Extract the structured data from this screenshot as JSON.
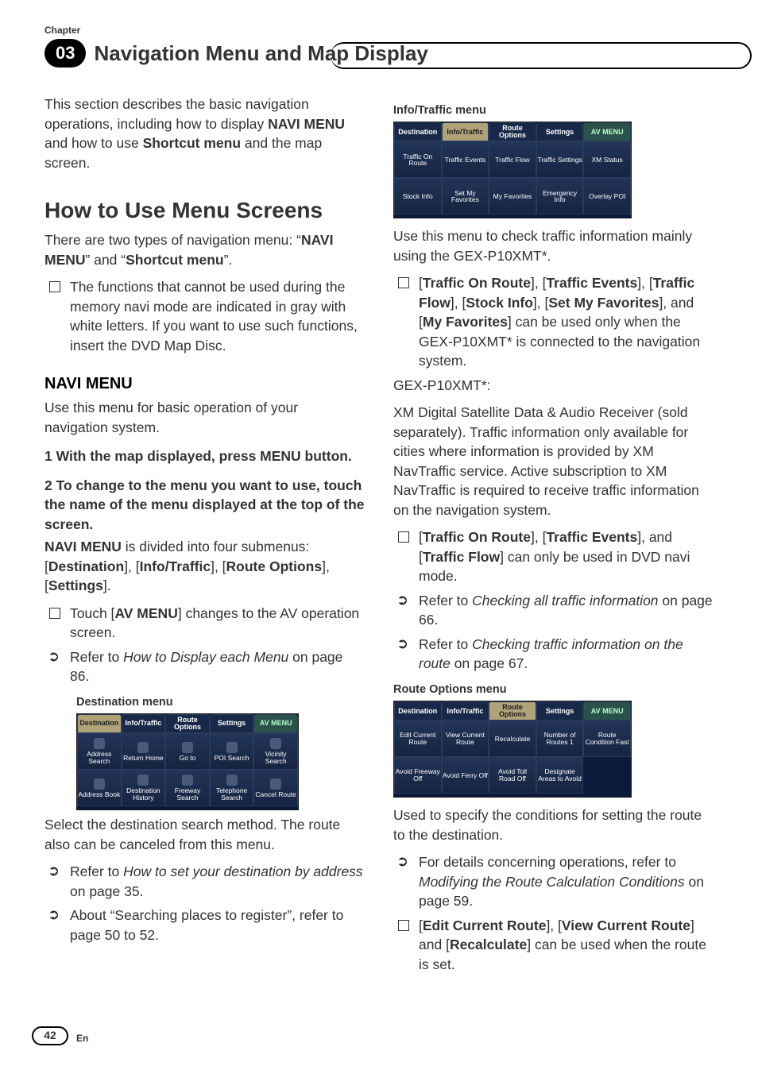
{
  "header": {
    "chapter_label": "Chapter",
    "chapter_num": "03",
    "chapter_title": "Navigation Menu and Map Display"
  },
  "left": {
    "intro": "This section describes the basic navigation operations, including how to display ",
    "intro_bold1": "NAVI MENU",
    "intro_mid": " and how to use ",
    "intro_bold2": "Shortcut menu",
    "intro_end": " and the map screen.",
    "h1": "How to Use Menu Screens",
    "p1_a": "There are two types of navigation menu: “",
    "p1_b": "NAVI MENU",
    "p1_c": "” and “",
    "p1_d": "Shortcut menu",
    "p1_e": "”.",
    "note1": "The functions that cannot be used during the memory navi mode are indicated in gray with white letters. If you want to use such functions, insert the DVD Map Disc.",
    "h2": "NAVI MENU",
    "p2": "Use this menu for basic operation of your navigation system.",
    "step1": "1    With the map displayed, press MENU button.",
    "step2": "2    To change to the menu you want to use, touch the name of the menu displayed at the top of the screen.",
    "p3_a": "NAVI MENU",
    "p3_b": " is divided into four submenus: [",
    "p3_c": "Destination",
    "p3_d": "], [",
    "p3_e": "Info/Traffic",
    "p3_f": "], [",
    "p3_g": "Route Options",
    "p3_h": "], [",
    "p3_i": "Settings",
    "p3_j": "].",
    "b1_a": "Touch [",
    "b1_b": "AV MENU",
    "b1_c": "] changes to the AV operation screen.",
    "b2_a": "Refer to ",
    "b2_b": "How to Display each Menu",
    "b2_c": " on page 86.",
    "caption1": "Destination menu",
    "p4": "Select the destination search method. The route also can be canceled from this menu.",
    "b3_a": "Refer to ",
    "b3_b": "How to set your destination by address",
    "b3_c": " on page 35.",
    "b4": "About “Searching places to register”, refer to page 50 to 52."
  },
  "right": {
    "caption1": "Info/Traffic menu",
    "p1": "Use this menu to check traffic information mainly using the GEX-P10XMT*.",
    "b1_a": "[",
    "b1_b": "Traffic On Route",
    "b1_c": "], [",
    "b1_d": "Traffic Events",
    "b1_e": "], [",
    "b1_f": "Traffic Flow",
    "b1_g": "], [",
    "b1_h": "Stock Info",
    "b1_i": "], [",
    "b1_j": "Set My Favorites",
    "b1_k": "], and [",
    "b1_l": "My Favorites",
    "b1_m": "] can be used only when the GEX-P10XMT* is connected to the navigation system.",
    "p2": "GEX-P10XMT*:",
    "p3": "XM Digital Satellite Data & Audio Receiver (sold separately). Traffic information only available for cities where information is provided by XM NavTraffic service. Active subscription to XM NavTraffic is required to receive traffic information on the navigation system.",
    "b2_a": "[",
    "b2_b": "Traffic On Route",
    "b2_c": "], [",
    "b2_d": "Traffic Events",
    "b2_e": "], and [",
    "b2_f": "Traffic Flow",
    "b2_g": "] can only be used in DVD navi mode.",
    "b3_a": "Refer to ",
    "b3_b": "Checking all traffic information",
    "b3_c": " on page 66.",
    "b4_a": "Refer to ",
    "b4_b": "Checking traffic information on the route",
    "b4_c": " on page 67.",
    "caption2": "Route Options menu",
    "p4": "Used to specify the conditions for setting the route to the destination.",
    "b5_a": "For details concerning operations, refer to ",
    "b5_b": "Modifying the Route Calculation Conditions",
    "b5_c": " on page 59.",
    "b6_a": "[",
    "b6_b": "Edit Current Route",
    "b6_c": "], [",
    "b6_d": "View Current Route",
    "b6_e": "] and [",
    "b6_f": "Recalculate",
    "b6_g": "] can be used when the route is set."
  },
  "menus": {
    "destination": {
      "tabs": [
        "Destination",
        "Info/Traffic",
        "Route Options",
        "Settings",
        "AV MENU"
      ],
      "active": 0,
      "row1": [
        "Address Search",
        "Return Home",
        "Go to",
        "POI Search",
        "Vicinity Search"
      ],
      "row2": [
        "Address Book",
        "Destination History",
        "Freeway Search",
        "Telephone Search",
        "Cancel Route"
      ]
    },
    "info": {
      "tabs": [
        "Destination",
        "Info/Traffic",
        "Route Options",
        "Settings",
        "AV MENU"
      ],
      "active": 1,
      "row1": [
        "Traffic On Route",
        "Traffic Events",
        "Traffic Flow",
        "Traffic Settings",
        "XM Status"
      ],
      "row2": [
        "Stock Info",
        "Set My Favorites",
        "My Favorites",
        "Emergency Info",
        "Overlay POI"
      ]
    },
    "route": {
      "tabs": [
        "Destination",
        "Info/Traffic",
        "Route Options",
        "Settings",
        "AV MENU"
      ],
      "active": 2,
      "row1": [
        "Edit Current Route",
        "View Current Route",
        "Recalculate",
        "Number of Routes 1",
        "Route Condition Fast"
      ],
      "row2": [
        "Avoid Freeway Off",
        "Avoid Ferry Off",
        "Avoid Toll Road Off",
        "Designate Areas to Avoid",
        ""
      ]
    }
  },
  "footer": {
    "page": "42",
    "lang": "En"
  }
}
